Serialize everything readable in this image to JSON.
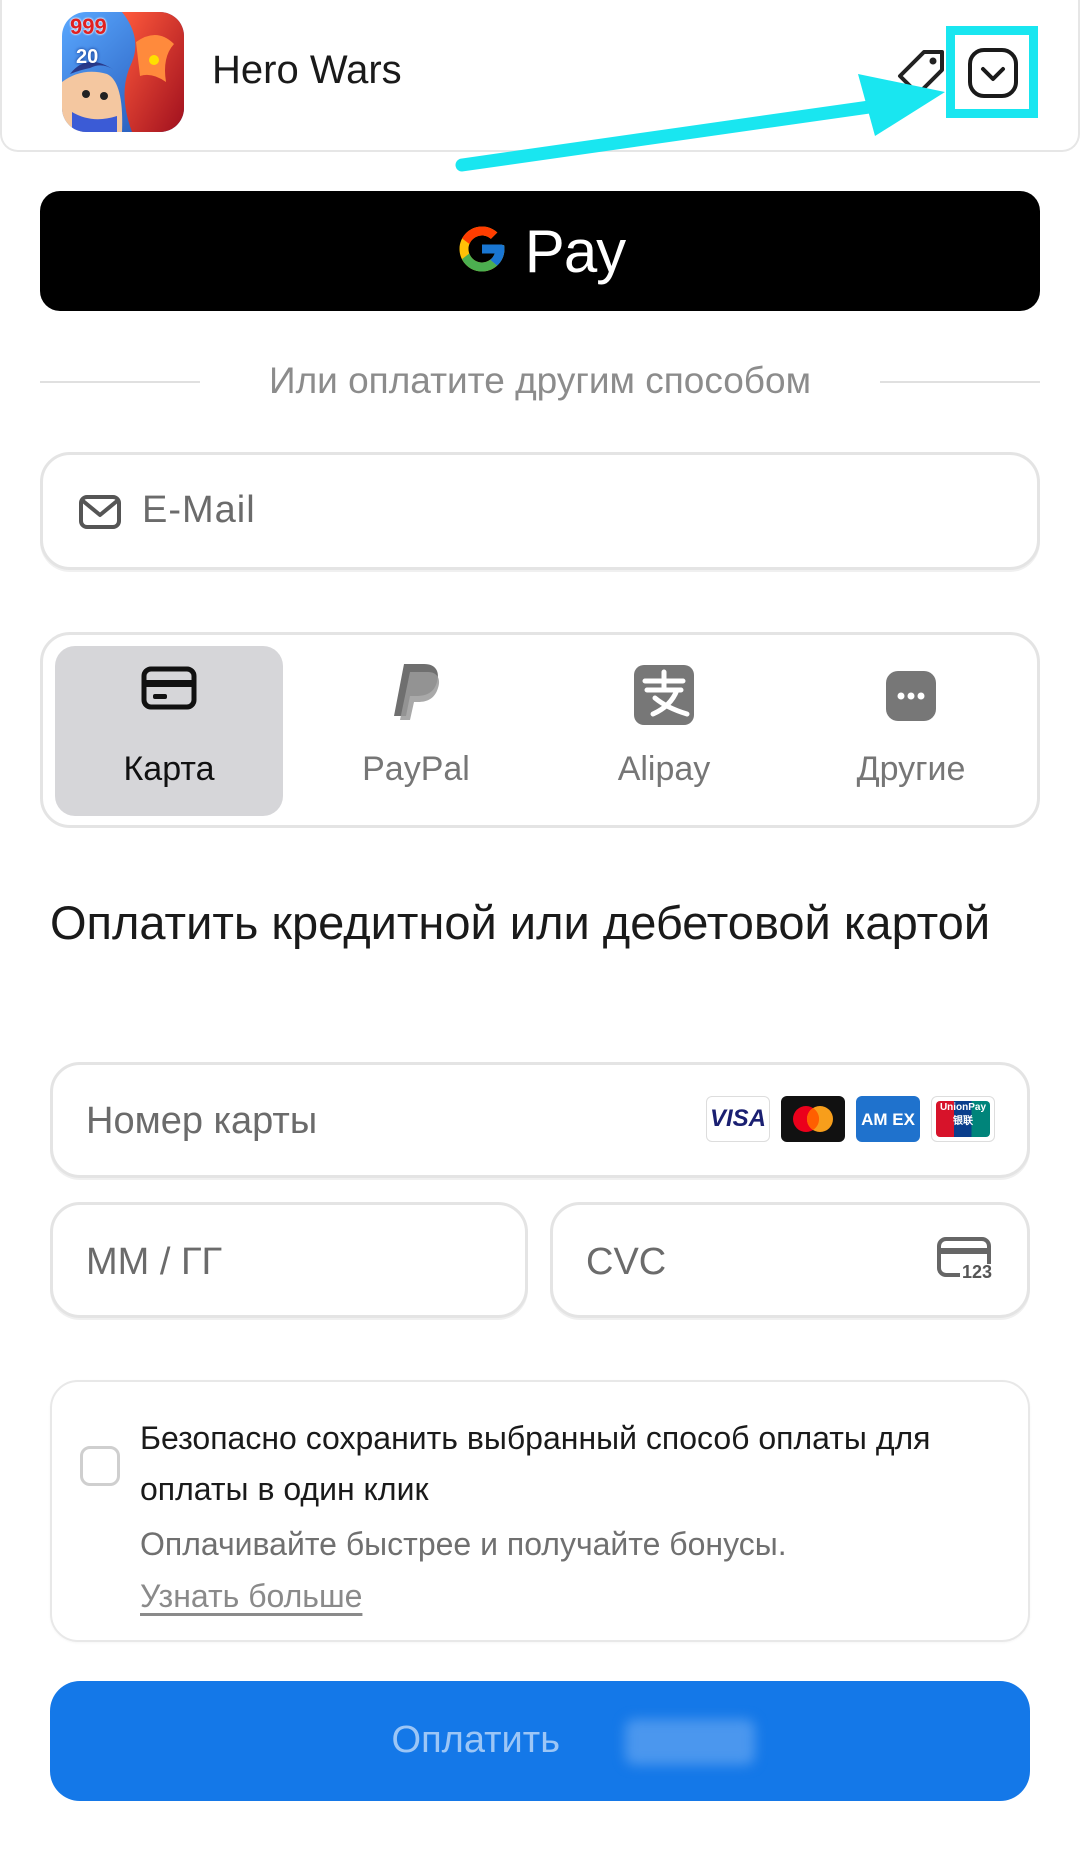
{
  "header": {
    "app_title": "Hero Wars",
    "icon_badges": [
      "999",
      "20"
    ],
    "icons": [
      "app-icon",
      "price-tag-icon",
      "chevron-down-icon"
    ]
  },
  "gpay": {
    "label": "Pay",
    "icon": "google-g-icon"
  },
  "divider": {
    "text": "Или оплатите другим способом"
  },
  "email": {
    "placeholder": "E-Mail",
    "icon": "mail-icon"
  },
  "methods": [
    {
      "label": "Карта",
      "icon": "credit-card-icon",
      "active": true
    },
    {
      "label": "PayPal",
      "icon": "paypal-icon",
      "active": false
    },
    {
      "label": "Alipay",
      "icon": "alipay-icon",
      "active": false
    },
    {
      "label": "Другие",
      "icon": "more-icon",
      "active": false
    }
  ],
  "card_section": {
    "title": "Оплатить кредитной или дебетовой картой",
    "card_number_placeholder": "Номер карты",
    "brands": [
      "VISA",
      "Mastercard",
      "AMEX",
      "UnionPay"
    ],
    "amex_text": "AM EX",
    "unionpay_text": "UnionPay 银联",
    "expiry_placeholder": "ММ / ГГ",
    "cvc_placeholder": "CVC",
    "cvc_icon_text": "123"
  },
  "save_option": {
    "title": "Безопасно сохранить выбранный способ оплаты для оплаты в один клик",
    "subtitle": "Оплачивайте быстрее и получайте бонусы.",
    "link": "Узнать больше",
    "checked": false
  },
  "pay_button": {
    "label": "Оплатить"
  },
  "colors": {
    "highlight": "#19e6f0",
    "pay_button": "#1478e8",
    "gpay_bg": "#000000",
    "active_method": "#d6d6d9"
  }
}
